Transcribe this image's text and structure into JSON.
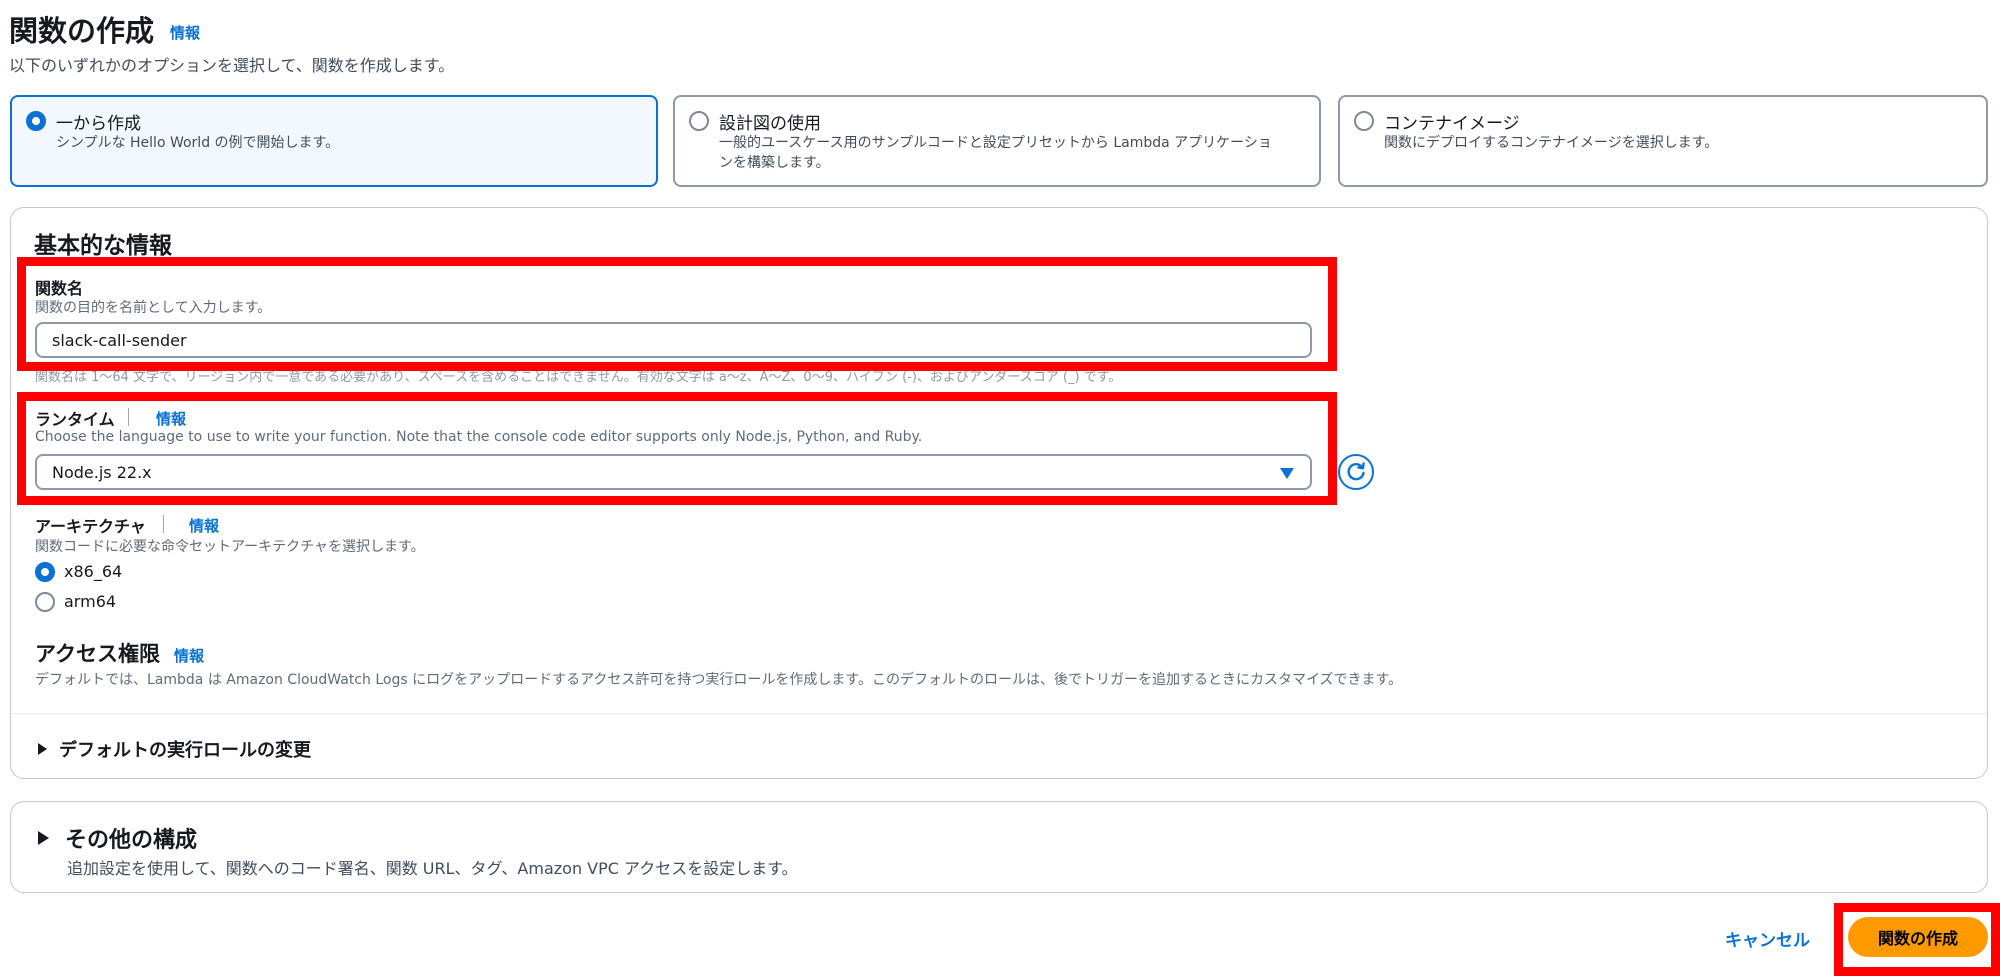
{
  "header": {
    "title": "関数の作成",
    "info_link": "情報",
    "description": "以下のいずれかのオプションを選択して、関数を作成します。"
  },
  "options": [
    {
      "title": "一から作成",
      "description": "シンプルな Hello World の例で開始します。",
      "selected": true
    },
    {
      "title": "設計図の使用",
      "description_line1": "一般的ユースケース用のサンプルコードと設定プリセットから Lambda アプリケーショ",
      "description_line2": "ンを構築します。",
      "selected": false
    },
    {
      "title": "コンテナイメージ",
      "description": "関数にデプロイするコンテナイメージを選択します。",
      "selected": false
    }
  ],
  "basic_info": {
    "title": "基本的な情報",
    "function_name": {
      "label": "関数名",
      "description": "関数の目的を名前として入力します。",
      "value": "slack-call-sender",
      "constraint": "関数名は 1～64 文字で、リージョン内で一意である必要があり、スペースを含めることはできません。有効な文字は a～z、A～Z、0～9、ハイフン (-)、およびアンダースコア (_) です。"
    },
    "runtime": {
      "label": "ランタイム",
      "info_link": "情報",
      "description": "Choose the language to use to write your function. Note that the console code editor supports only Node.js, Python, and Ruby.",
      "value": "Node.js 22.x"
    },
    "architecture": {
      "label": "アーキテクチャ",
      "info_link": "情報",
      "description": "関数コードに必要な命令セットアーキテクチャを選択します。",
      "options": [
        {
          "label": "x86_64",
          "selected": true
        },
        {
          "label": "arm64",
          "selected": false
        }
      ]
    },
    "permissions": {
      "title": "アクセス権限",
      "info_link": "情報",
      "description": "デフォルトでは、Lambda は Amazon CloudWatch Logs にログをアップロードするアクセス許可を持つ実行ロールを作成します。このデフォルトのロールは、後でトリガーを追加するときにカスタマイズできます。",
      "expander": "デフォルトの実行ロールの変更"
    }
  },
  "other_config": {
    "title": "その他の構成",
    "description": "追加設定を使用して、関数へのコード署名、関数 URL、タグ、Amazon VPC アクセスを設定します。"
  },
  "footer": {
    "cancel_label": "キャンセル",
    "create_label": "関数の作成"
  },
  "colors": {
    "accent": "#0972d3",
    "primary_button": "#ff9900",
    "highlight_box": "#ff0000"
  },
  "icons": [
    "refresh-icon",
    "caret-down-icon",
    "expand-triangle-icon"
  ]
}
